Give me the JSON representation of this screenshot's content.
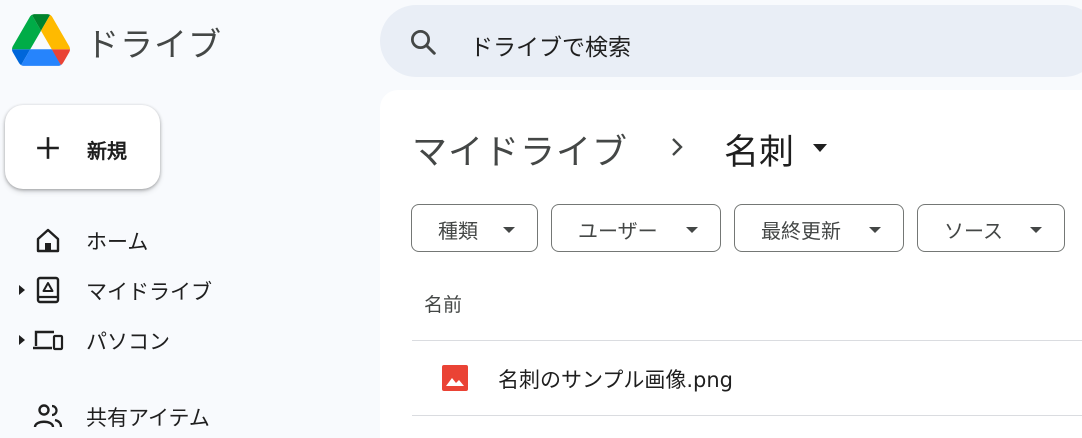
{
  "header": {
    "app_title": "ドライブ",
    "logo_icon": "google-drive-logo",
    "search": {
      "placeholder": "ドライブで検索",
      "icon": "search-icon"
    }
  },
  "sidebar": {
    "new_button": {
      "label": "新規",
      "icon": "plus-icon"
    },
    "items": [
      {
        "label": "ホーム",
        "icon": "home-icon",
        "expandable": false
      },
      {
        "label": "マイドライブ",
        "icon": "my-drive-icon",
        "expandable": true
      },
      {
        "label": "パソコン",
        "icon": "computers-icon",
        "expandable": true
      },
      {
        "label": "共有アイテム",
        "icon": "shared-people-icon",
        "expandable": false
      }
    ]
  },
  "main": {
    "breadcrumb": {
      "root": "マイドライブ",
      "current": "名刺"
    },
    "filters": [
      {
        "label": "種類"
      },
      {
        "label": "ユーザー"
      },
      {
        "label": "最終更新"
      },
      {
        "label": "ソース"
      }
    ],
    "columns": {
      "name": "名前"
    },
    "files": [
      {
        "name": "名刺のサンプル画像.png",
        "icon": "image-file-icon",
        "icon_color": "#ea4335"
      }
    ]
  },
  "colors": {
    "page_bg": "#f8fafd",
    "search_bg": "#e9eef6",
    "panel_bg": "#ffffff",
    "text_primary": "#1f1f1f",
    "text_secondary": "#444746",
    "drive_green": "#0f9d58",
    "drive_yellow": "#f4b400",
    "drive_blue": "#4285f4",
    "drive_red": "#db4437"
  }
}
